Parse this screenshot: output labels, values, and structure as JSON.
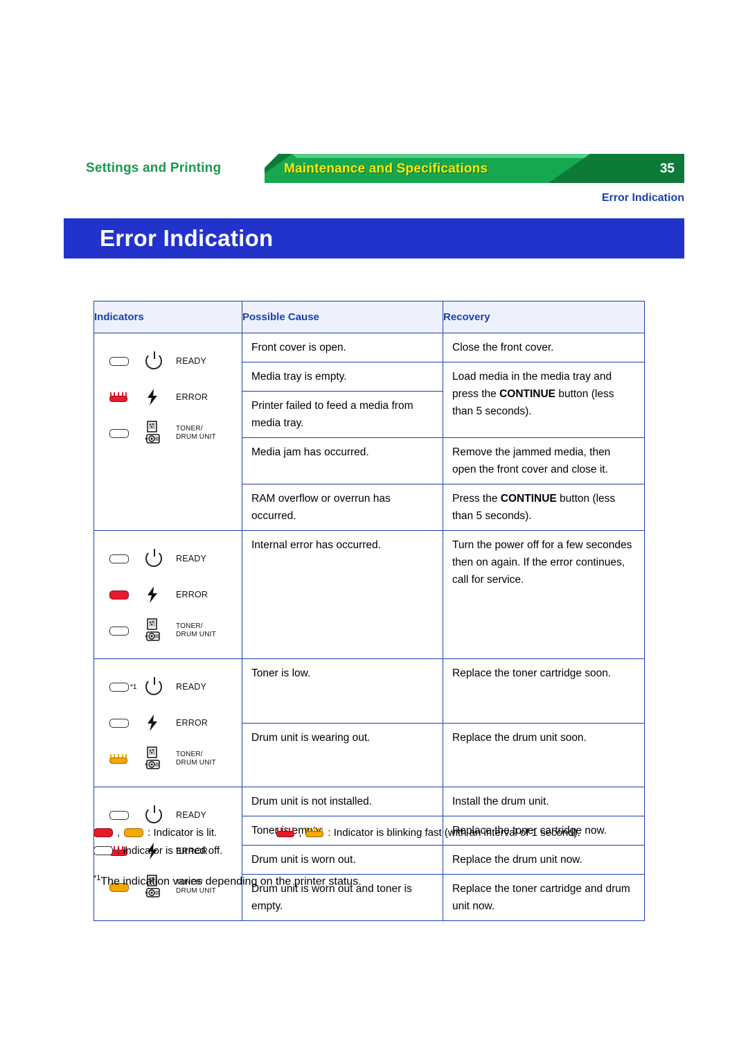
{
  "header": {
    "tab_settings": "Settings and Printing",
    "tab_maintenance": "Maintenance and Specifications",
    "page_number": "35",
    "section_label": "Error Indication",
    "title": "Error Indication"
  },
  "table": {
    "columns": [
      "Indicators",
      "Possible Cause",
      "Recovery"
    ],
    "indicator_labels": {
      "ready": "READY",
      "error": "ERROR",
      "toner": "TONER/",
      "drum": "DRUM UNIT"
    },
    "groups": [
      {
        "lamps": [
          "off",
          "blink-red",
          "off"
        ],
        "footnote_mark": "",
        "rows": [
          {
            "cause": "Front cover is open.",
            "recovery": "Close the front cover."
          },
          {
            "cause": "Media tray is empty.",
            "recovery": "Load media in the media tray and press the CONTINUE button (less than 5 seconds)."
          },
          {
            "cause": "Printer failed to feed a media from media tray.",
            "recovery": ""
          },
          {
            "cause": "Media jam has occurred.",
            "recovery": "Remove the jammed media, then open the front cover and close it."
          },
          {
            "cause": "RAM overflow or overrun has occurred.",
            "recovery": "Press the CONTINUE button (less than 5 seconds)."
          }
        ]
      },
      {
        "lamps": [
          "off",
          "red",
          "off"
        ],
        "footnote_mark": "",
        "rows": [
          {
            "cause": "Internal error has occurred.",
            "recovery": "Turn the power off for a few secondes then on again. If the error continues, call for service."
          }
        ]
      },
      {
        "lamps": [
          "off",
          "off",
          "blink-orange"
        ],
        "footnote_mark": "*1",
        "rows": [
          {
            "cause": "Toner is low.",
            "recovery": "Replace the toner cartridge soon."
          },
          {
            "cause": "Drum unit is wearing out.",
            "recovery": "Replace the drum unit soon."
          }
        ]
      },
      {
        "lamps": [
          "off",
          "blink-red",
          "orange"
        ],
        "footnote_mark": "",
        "rows": [
          {
            "cause": "Drum unit is not installed.",
            "recovery": "Install the drum unit."
          },
          {
            "cause": "Toner is empty.",
            "recovery": "Replace the toner cartridge now."
          },
          {
            "cause": "Drum unit is worn out.",
            "recovery": "Replace the drum unit now."
          },
          {
            "cause": "Drum unit is worn out and toner is empty.",
            "recovery": "Replace the toner cartridge and drum unit now."
          }
        ]
      }
    ]
  },
  "legend": {
    "separator": ",",
    "lit_text": ": Indicator is lit.",
    "blink_text": ": Indicator is blinking fast (with an interval of 1 second).",
    "off_text": ": Indicator is turned off.",
    "footnote_mark": "*1",
    "footnote_text": "The indication varies depending on the printer status."
  },
  "colors": {
    "banner_green": "#1a9a4a",
    "banner_yellow": "#ffe800",
    "title_blue": "#2233cc",
    "table_border_blue": "#1a3fb0",
    "lamp_red": "#e8192c",
    "lamp_orange": "#f5a800"
  }
}
